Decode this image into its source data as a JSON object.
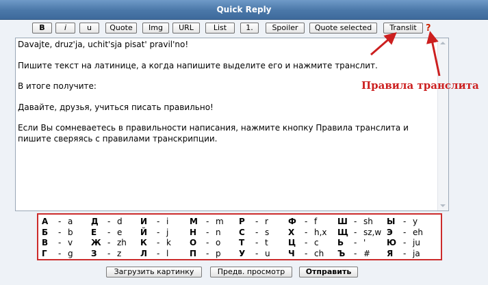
{
  "window": {
    "title": "Quick Reply"
  },
  "toolbar": {
    "bold": "B",
    "italic": "i",
    "underline": "u",
    "quote": "Quote",
    "img": "Img",
    "url": "URL",
    "list": "List",
    "list_numbered": "1.",
    "spoiler": "Spoiler",
    "quote_selected": "Quote selected",
    "translit": "Translit",
    "help": "?"
  },
  "editor": {
    "text": "Davajte, druz'ja, uchit'sja pisat' pravil'no!\n\nПишите текст на латинице, а когда напишите выделите его и нажмите транслит.\n\nВ итоге получите:\n\nДавайте, друзья, учиться писать правильно!\n\nЕсли Вы сомневаетесь в правильности написания, нажмите кнопку Правила транслита и пишите сверяясь с правилами транскрипции."
  },
  "annotation": {
    "label": "Правила транслита",
    "color": "#cc1f1f"
  },
  "translit_rows": [
    [
      [
        "А",
        "a"
      ],
      [
        "Д",
        "d"
      ],
      [
        "И",
        "i"
      ],
      [
        "М",
        "m"
      ],
      [
        "Р",
        "r"
      ],
      [
        "Ф",
        "f"
      ],
      [
        "Ш",
        "sh"
      ],
      [
        "Ы",
        "y"
      ]
    ],
    [
      [
        "Б",
        "b"
      ],
      [
        "Е",
        "e"
      ],
      [
        "Й",
        "j"
      ],
      [
        "Н",
        "n"
      ],
      [
        "С",
        "s"
      ],
      [
        "Х",
        "h,x"
      ],
      [
        "Щ",
        "sz,w"
      ],
      [
        "Э",
        "eh"
      ]
    ],
    [
      [
        "В",
        "v"
      ],
      [
        "Ж",
        "zh"
      ],
      [
        "К",
        "k"
      ],
      [
        "О",
        "o"
      ],
      [
        "Т",
        "t"
      ],
      [
        "Ц",
        "c"
      ],
      [
        "Ь",
        "'"
      ],
      [
        "Ю",
        "ju"
      ]
    ],
    [
      [
        "Г",
        "g"
      ],
      [
        "З",
        "z"
      ],
      [
        "Л",
        "l"
      ],
      [
        "П",
        "p"
      ],
      [
        "У",
        "u"
      ],
      [
        "Ч",
        "ch"
      ],
      [
        "Ъ",
        "#"
      ],
      [
        "Я",
        "ja"
      ]
    ]
  ],
  "buttons": {
    "upload_image": "Загрузить картинку",
    "preview": "Предв. просмотр",
    "submit": "Отправить"
  }
}
